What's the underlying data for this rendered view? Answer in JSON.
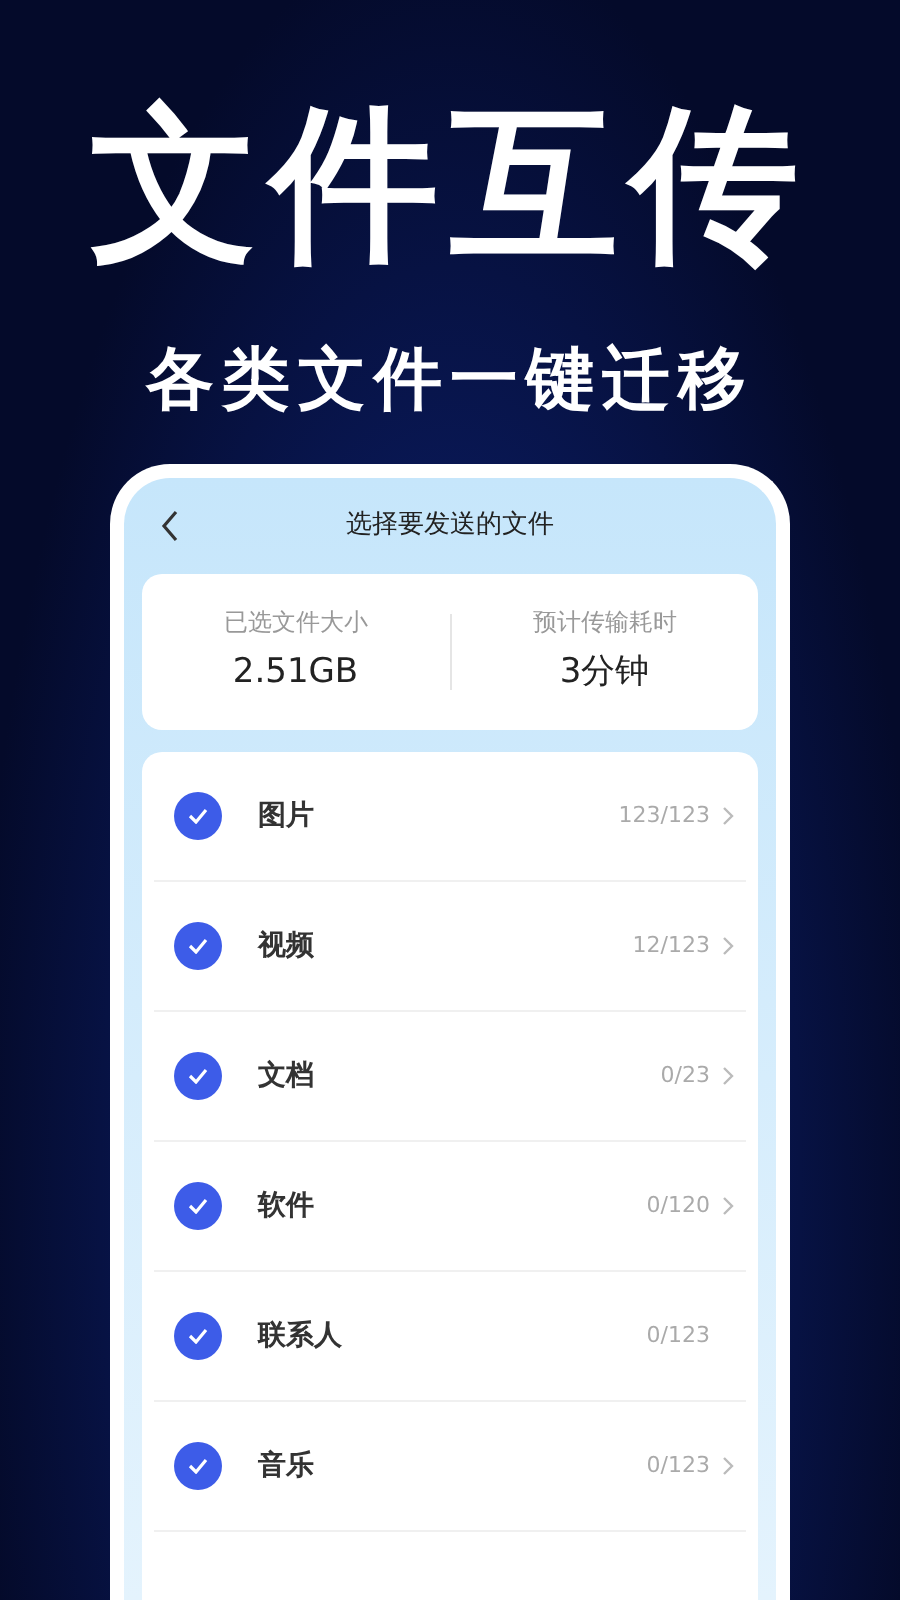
{
  "headline": "文件互传",
  "subheadline": "各类文件一键迁移",
  "screen": {
    "title": "选择要发送的文件",
    "stats": [
      {
        "label": "已选文件大小",
        "value": "2.51GB"
      },
      {
        "label": "预计传输耗时",
        "value": "3分钟"
      }
    ],
    "categories": [
      {
        "name": "图片",
        "count": "123/123",
        "checked": true,
        "chevron": true
      },
      {
        "name": "视频",
        "count": "12/123",
        "checked": true,
        "chevron": true
      },
      {
        "name": "文档",
        "count": "0/23",
        "checked": true,
        "chevron": true
      },
      {
        "name": "软件",
        "count": "0/120",
        "checked": true,
        "chevron": true
      },
      {
        "name": "联系人",
        "count": "0/123",
        "checked": true,
        "chevron": false
      },
      {
        "name": "音乐",
        "count": "0/123",
        "checked": true,
        "chevron": true
      }
    ]
  }
}
